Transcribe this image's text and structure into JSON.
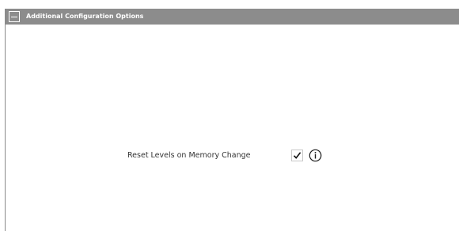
{
  "panel": {
    "title": "Additional Configuration Options",
    "collapse_icon": "minus-icon"
  },
  "options": [
    {
      "label": "Reset Levels on Memory Change",
      "checked": true,
      "check_icon": "checkmark-icon",
      "info_icon": "info-icon"
    }
  ],
  "colors": {
    "header_background": "#8c8c8c",
    "header_text": "#ffffff",
    "label_text": "#333333",
    "panel_background": "#ffffff"
  }
}
